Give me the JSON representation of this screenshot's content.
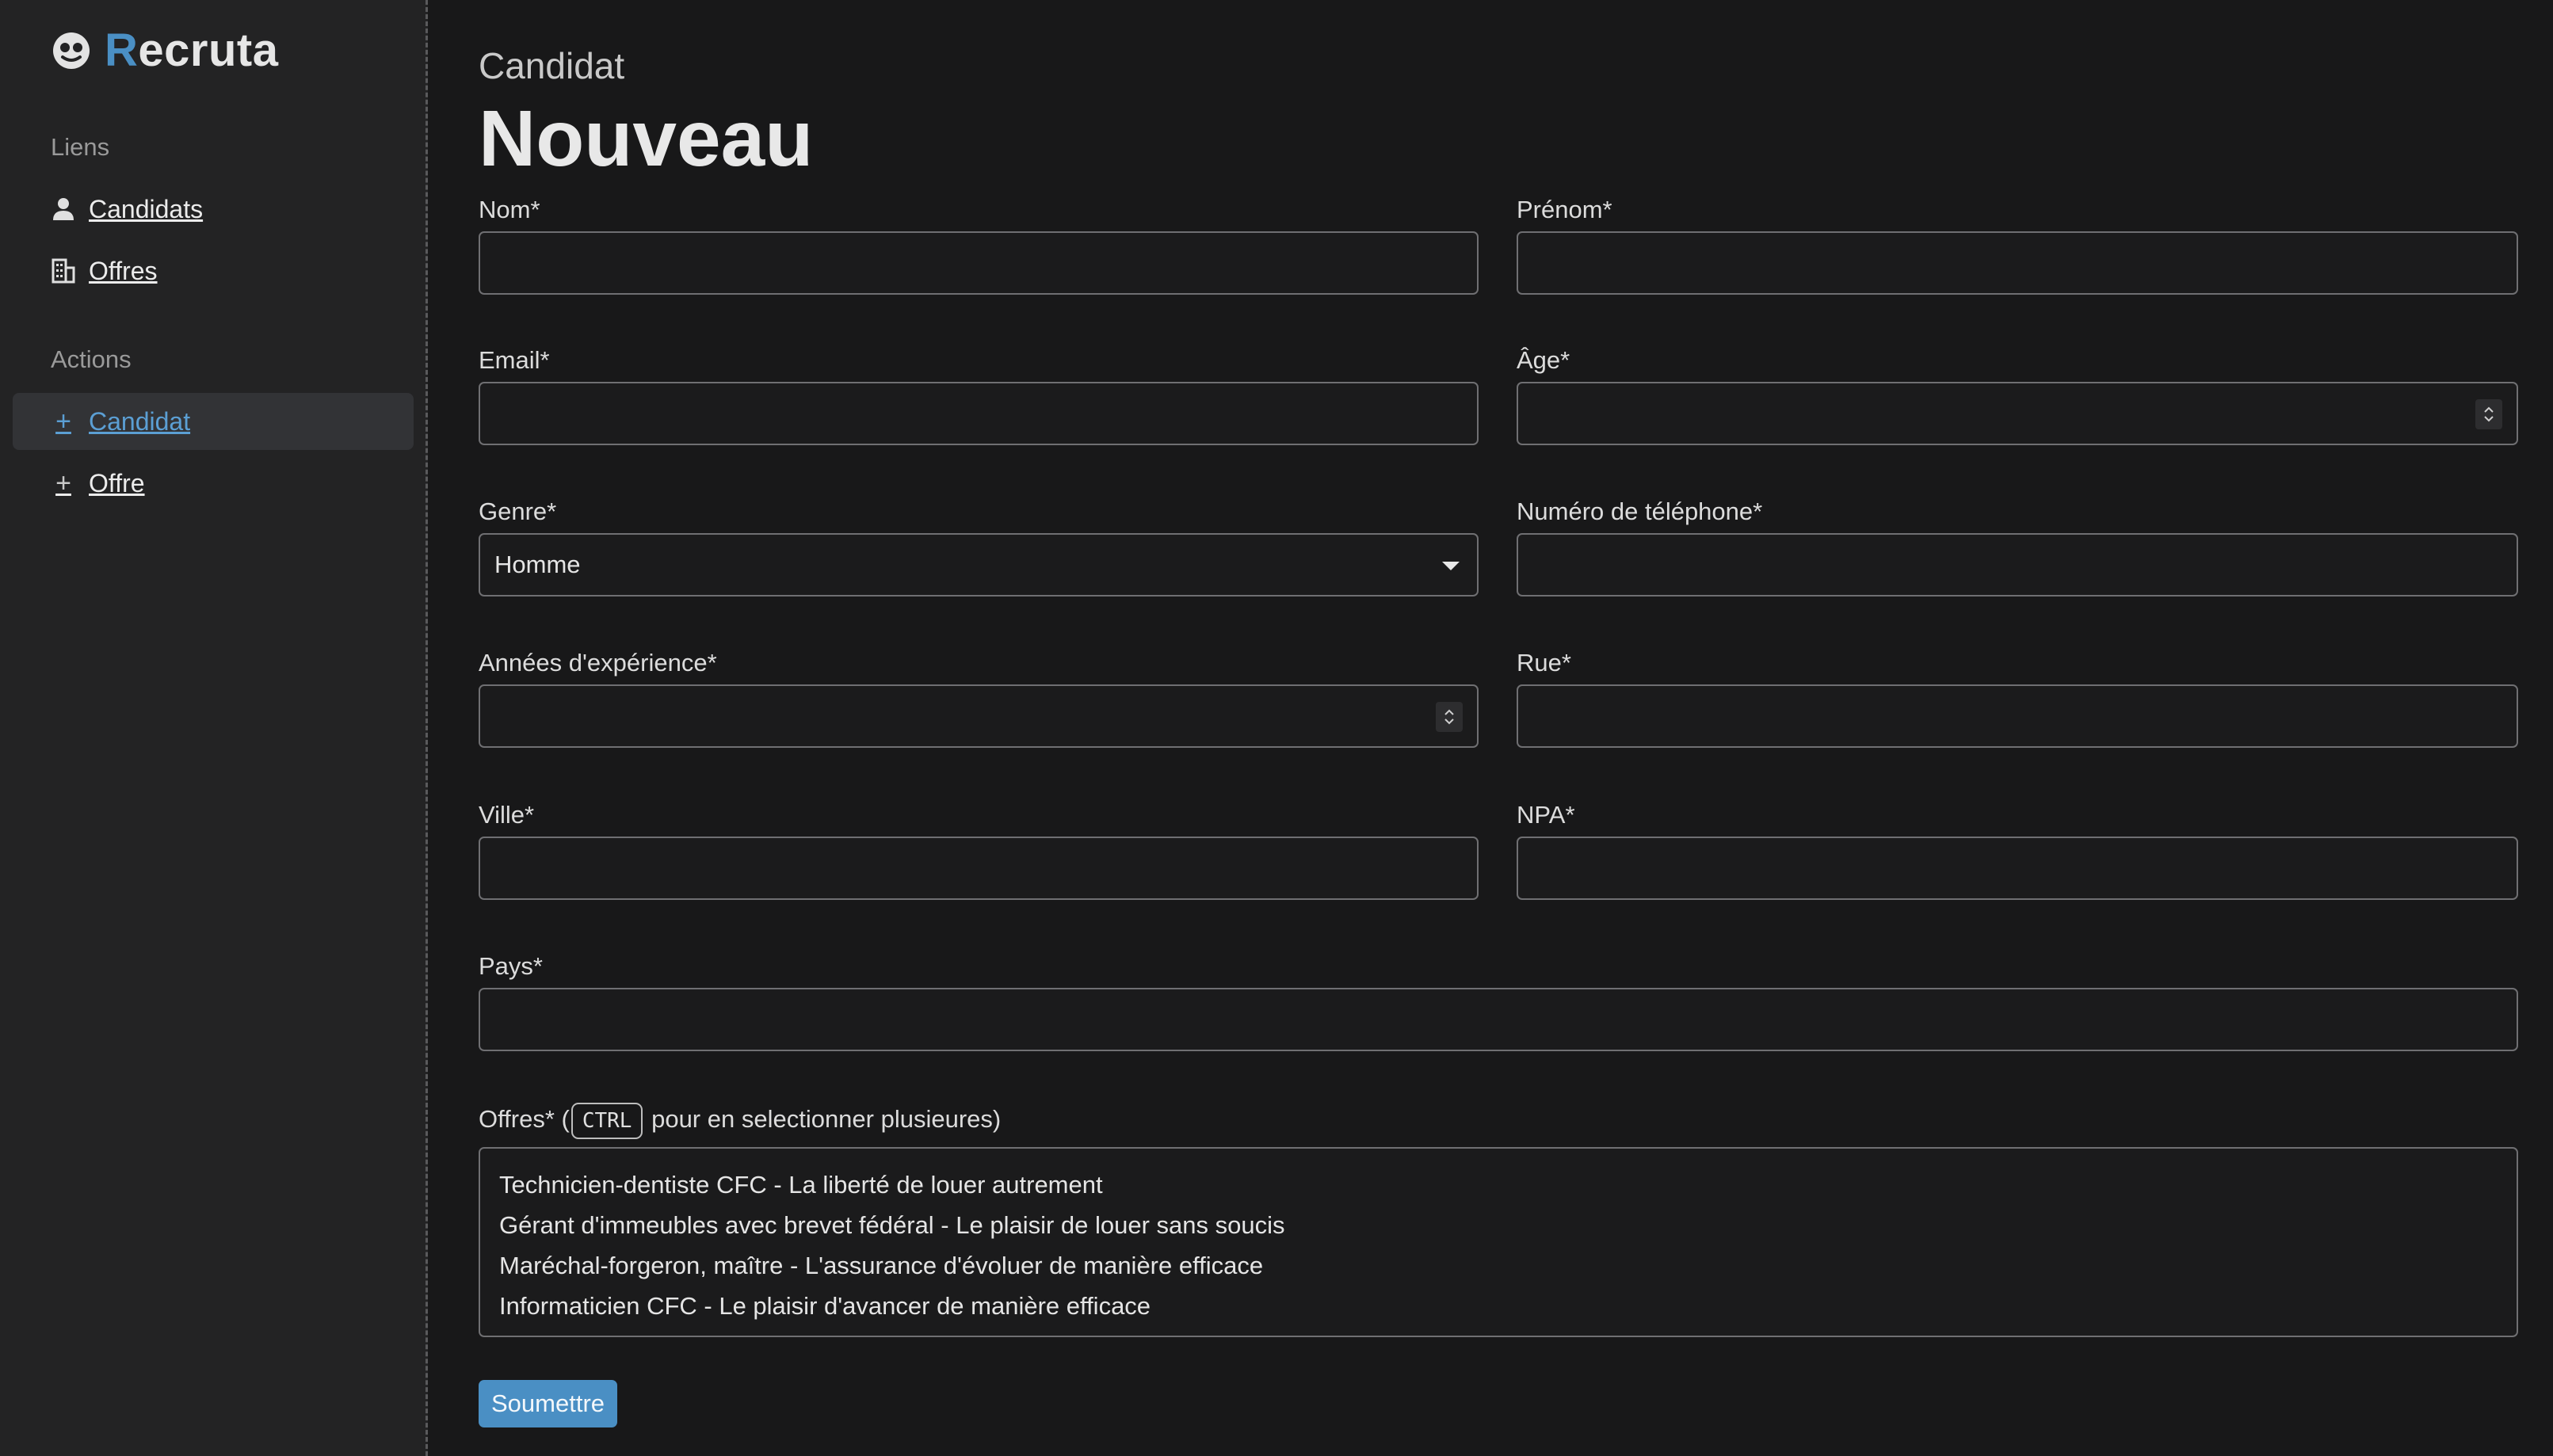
{
  "brand": {
    "first_letter": "R",
    "rest": "ecruta"
  },
  "sidebar": {
    "links_title": "Liens",
    "links": [
      {
        "label": "Candidats",
        "icon": "person-icon"
      },
      {
        "label": "Offres",
        "icon": "building-icon"
      }
    ],
    "actions_title": "Actions",
    "actions": [
      {
        "label": "Candidat",
        "icon": "plus-icon",
        "active": true
      },
      {
        "label": "Offre",
        "icon": "plus-icon",
        "active": false
      }
    ]
  },
  "page": {
    "subtitle": "Candidat",
    "title": "Nouveau"
  },
  "form": {
    "nom": {
      "label": "Nom*",
      "value": ""
    },
    "prenom": {
      "label": "Prénom*",
      "value": ""
    },
    "email": {
      "label": "Email*",
      "value": ""
    },
    "age": {
      "label": "Âge*",
      "value": ""
    },
    "genre": {
      "label": "Genre*",
      "value": "Homme"
    },
    "telephone": {
      "label": "Numéro de téléphone*",
      "value": ""
    },
    "experience": {
      "label": "Années d'expérience*",
      "value": ""
    },
    "rue": {
      "label": "Rue*",
      "value": ""
    },
    "ville": {
      "label": "Ville*",
      "value": ""
    },
    "npa": {
      "label": "NPA*",
      "value": ""
    },
    "pays": {
      "label": "Pays*",
      "value": ""
    },
    "offres": {
      "label_prefix": "Offres* (",
      "key": "CTRL",
      "label_suffix": " pour en selectionner plusieures)",
      "options": [
        "Technicien-dentiste CFC - La liberté de louer autrement",
        "Gérant d'immeubles avec brevet fédéral - Le plaisir de louer sans soucis",
        "Maréchal-forgeron, maître - L'assurance d'évoluer de manière efficace",
        "Informaticien CFC - Le plaisir d'avancer de manière efficace"
      ]
    },
    "submit_label": "Soumettre"
  }
}
